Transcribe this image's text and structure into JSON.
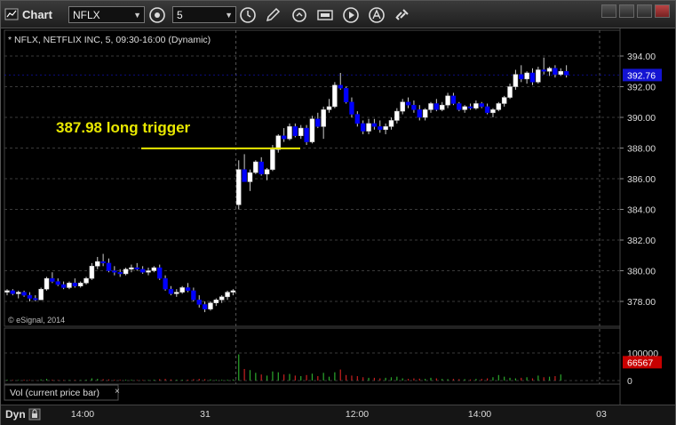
{
  "window": {
    "app_title": "Chart"
  },
  "toolbar": {
    "symbol": "NFLX",
    "interval": "5"
  },
  "header_text": "* NFLX, NETFLIX INC, 5, 09:30-16:00 (Dynamic)",
  "copyright": "© eSignal, 2014",
  "annotation": "387.98 long trigger",
  "volume_label": "Vol (current price bar)",
  "bottom": {
    "mode": "Dyn"
  },
  "colors": {
    "up": "#ffffff",
    "down": "#0000ff",
    "trigger": "#e8e800",
    "price_badge": "#1414d2",
    "vol_badge": "#c80000",
    "vol_up": "#2ca82c",
    "vol_down": "#c82020"
  },
  "icons": [
    "app-icon",
    "settings-icon",
    "clock-icon",
    "pencil-icon",
    "replay-icon",
    "hd-icon",
    "play-icon",
    "alert-icon",
    "link-icon"
  ],
  "chart_data": {
    "type": "candlestick",
    "price_axis": {
      "ticks": [
        "394.00",
        "392.00",
        "390.00",
        "388.00",
        "386.00",
        "384.00",
        "382.00",
        "380.00",
        "378.00"
      ],
      "range": [
        377.0,
        394.6
      ]
    },
    "volume_axis": {
      "ticks": [
        "100000",
        "0"
      ]
    },
    "time_axis": {
      "ticks": [
        "14:00",
        "31",
        "12:00",
        "14:00",
        "03"
      ]
    },
    "last_price": "392.76",
    "last_volume": "66567",
    "trigger_level": 387.98,
    "candles": [
      [
        378.6,
        378.8,
        378.4,
        378.7
      ],
      [
        378.7,
        378.8,
        378.4,
        378.5
      ],
      [
        378.5,
        378.7,
        378.2,
        378.6
      ],
      [
        378.6,
        378.7,
        378.3,
        378.4
      ],
      [
        378.4,
        378.6,
        378.0,
        378.2
      ],
      [
        378.2,
        378.4,
        378.0,
        378.1
      ],
      [
        378.1,
        378.9,
        378.1,
        378.8
      ],
      [
        378.8,
        379.6,
        378.7,
        379.5
      ],
      [
        379.5,
        379.9,
        379.2,
        379.3
      ],
      [
        379.3,
        379.5,
        379.0,
        379.1
      ],
      [
        379.1,
        379.3,
        378.8,
        378.9
      ],
      [
        378.9,
        379.3,
        378.8,
        379.2
      ],
      [
        379.2,
        379.5,
        378.9,
        379.0
      ],
      [
        379.0,
        379.3,
        378.9,
        379.2
      ],
      [
        379.2,
        379.6,
        379.1,
        379.5
      ],
      [
        379.5,
        380.5,
        379.4,
        380.3
      ],
      [
        380.3,
        380.9,
        380.1,
        380.6
      ],
      [
        380.6,
        381.1,
        380.3,
        380.5
      ],
      [
        380.5,
        380.8,
        379.9,
        380.0
      ],
      [
        380.0,
        380.3,
        379.7,
        379.9
      ],
      [
        379.9,
        380.1,
        379.6,
        379.8
      ],
      [
        379.8,
        380.2,
        379.7,
        380.1
      ],
      [
        380.1,
        380.4,
        379.9,
        380.2
      ],
      [
        380.2,
        380.5,
        380.0,
        380.1
      ],
      [
        380.1,
        380.3,
        379.8,
        379.9
      ],
      [
        379.9,
        380.2,
        379.7,
        380.0
      ],
      [
        380.0,
        380.3,
        379.9,
        380.2
      ],
      [
        380.2,
        380.4,
        379.4,
        379.5
      ],
      [
        379.5,
        379.7,
        378.7,
        378.8
      ],
      [
        378.8,
        379.0,
        378.4,
        378.5
      ],
      [
        378.5,
        378.8,
        378.3,
        378.6
      ],
      [
        378.6,
        379.0,
        378.5,
        378.9
      ],
      [
        378.9,
        379.2,
        378.6,
        378.7
      ],
      [
        378.7,
        378.9,
        378.0,
        378.1
      ],
      [
        378.1,
        378.4,
        377.6,
        377.8
      ],
      [
        377.8,
        378.0,
        377.3,
        377.5
      ],
      [
        377.5,
        378.0,
        377.4,
        377.9
      ],
      [
        377.9,
        378.2,
        377.7,
        378.1
      ],
      [
        378.1,
        378.4,
        377.9,
        378.3
      ],
      [
        378.3,
        378.7,
        378.1,
        378.6
      ],
      [
        378.6,
        378.8,
        378.4,
        378.7
      ],
      [
        384.3,
        387.2,
        384.0,
        386.6
      ],
      [
        386.6,
        387.6,
        385.9,
        385.8
      ],
      [
        385.8,
        386.6,
        385.2,
        386.4
      ],
      [
        386.4,
        387.2,
        386.3,
        387.1
      ],
      [
        387.1,
        387.4,
        386.2,
        386.3
      ],
      [
        386.3,
        386.7,
        385.9,
        386.6
      ],
      [
        386.6,
        388.2,
        386.5,
        387.9
      ],
      [
        387.9,
        388.9,
        387.7,
        388.8
      ],
      [
        388.8,
        389.3,
        388.4,
        388.6
      ],
      [
        388.6,
        389.6,
        388.5,
        389.4
      ],
      [
        389.4,
        389.6,
        388.7,
        388.8
      ],
      [
        388.8,
        389.5,
        388.6,
        389.3
      ],
      [
        389.3,
        389.5,
        388.2,
        388.4
      ],
      [
        388.4,
        390.1,
        388.3,
        389.9
      ],
      [
        389.9,
        390.3,
        389.3,
        389.4
      ],
      [
        389.4,
        390.7,
        388.6,
        390.5
      ],
      [
        390.5,
        391.2,
        390.3,
        390.7
      ],
      [
        390.7,
        392.3,
        390.6,
        392.1
      ],
      [
        392.1,
        392.9,
        391.8,
        391.9
      ],
      [
        391.9,
        392.0,
        390.9,
        391.0
      ],
      [
        391.0,
        391.3,
        390.0,
        390.2
      ],
      [
        390.2,
        390.4,
        389.4,
        389.6
      ],
      [
        389.6,
        389.8,
        388.9,
        389.1
      ],
      [
        389.1,
        389.9,
        388.9,
        389.6
      ],
      [
        389.6,
        389.9,
        389.2,
        389.4
      ],
      [
        389.4,
        389.8,
        389.0,
        389.2
      ],
      [
        389.2,
        389.6,
        388.9,
        389.4
      ],
      [
        389.4,
        390.0,
        389.2,
        389.8
      ],
      [
        389.8,
        390.6,
        389.6,
        390.4
      ],
      [
        390.4,
        391.2,
        390.2,
        391.0
      ],
      [
        391.0,
        391.3,
        390.6,
        390.8
      ],
      [
        390.8,
        391.1,
        390.3,
        390.5
      ],
      [
        390.5,
        390.8,
        389.8,
        390.0
      ],
      [
        390.0,
        390.6,
        389.8,
        390.5
      ],
      [
        390.5,
        391.0,
        390.3,
        390.9
      ],
      [
        390.9,
        391.2,
        390.4,
        390.5
      ],
      [
        390.5,
        391.0,
        390.4,
        390.8
      ],
      [
        390.8,
        391.6,
        390.6,
        391.4
      ],
      [
        391.4,
        391.6,
        390.8,
        390.9
      ],
      [
        390.9,
        391.0,
        390.4,
        390.5
      ],
      [
        390.5,
        390.8,
        390.3,
        390.7
      ],
      [
        390.7,
        390.9,
        390.5,
        390.6
      ],
      [
        390.6,
        391.1,
        390.5,
        390.9
      ],
      [
        390.9,
        391.0,
        390.6,
        390.7
      ],
      [
        390.7,
        390.9,
        390.2,
        390.3
      ],
      [
        390.3,
        390.6,
        390.0,
        390.5
      ],
      [
        390.5,
        391.0,
        390.4,
        390.9
      ],
      [
        390.9,
        391.4,
        390.7,
        391.3
      ],
      [
        391.3,
        392.2,
        391.2,
        392.0
      ],
      [
        392.0,
        393.1,
        391.8,
        392.8
      ],
      [
        392.8,
        393.4,
        392.3,
        392.5
      ],
      [
        392.5,
        393.0,
        392.2,
        392.9
      ],
      [
        392.9,
        393.2,
        392.1,
        392.3
      ],
      [
        392.3,
        393.3,
        392.2,
        393.1
      ],
      [
        393.1,
        393.9,
        392.8,
        393.0
      ],
      [
        393.0,
        393.3,
        392.7,
        393.2
      ],
      [
        393.2,
        393.4,
        392.6,
        392.8
      ],
      [
        392.8,
        393.2,
        392.7,
        393.0
      ],
      [
        393.0,
        393.4,
        392.6,
        392.76
      ]
    ],
    "volumes": [
      3,
      2,
      2,
      3,
      2,
      1,
      4,
      6,
      3,
      2,
      2,
      2,
      2,
      2,
      3,
      8,
      6,
      5,
      4,
      3,
      3,
      3,
      3,
      2,
      2,
      2,
      3,
      5,
      6,
      4,
      3,
      3,
      3,
      5,
      6,
      5,
      4,
      3,
      3,
      3,
      4,
      95,
      42,
      38,
      28,
      22,
      18,
      33,
      30,
      22,
      24,
      18,
      16,
      20,
      25,
      16,
      28,
      14,
      30,
      40,
      20,
      18,
      16,
      12,
      10,
      10,
      8,
      10,
      12,
      14,
      8,
      6,
      8,
      7,
      6,
      10,
      8,
      6,
      5,
      6,
      5,
      5,
      4,
      6,
      6,
      8,
      12,
      20,
      14,
      10,
      8,
      10,
      12,
      8,
      18,
      12,
      14,
      16,
      22
    ]
  }
}
